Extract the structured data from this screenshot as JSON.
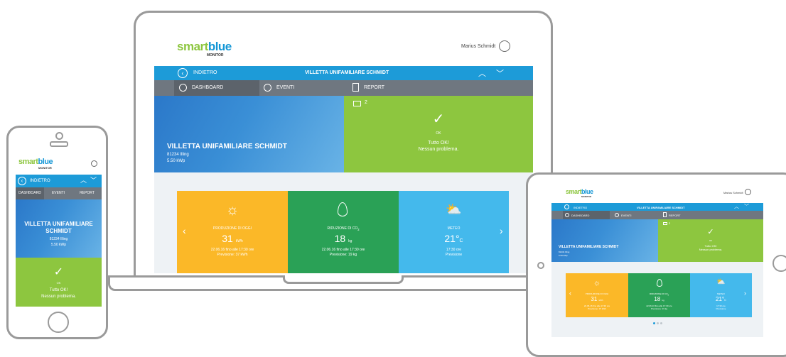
{
  "app": {
    "logo_part1": "smart",
    "logo_part2": "blue",
    "logo_sub": "MONITOR",
    "user_name": "Marius Schmidt"
  },
  "nav": {
    "back_label": "INDIETRO",
    "title": "VILLETTA UNIFAMILIARE SCHMIDT"
  },
  "tabs": [
    {
      "label": "DASHBOARD",
      "icon": "speedometer-icon"
    },
    {
      "label": "EVENTI",
      "icon": "clock-icon"
    },
    {
      "label": "REPORT",
      "icon": "document-icon"
    }
  ],
  "hero": {
    "title": "VILLETTA UNIFAMILIARE SCHMIDT",
    "address": "81234 Illing",
    "power": "5.50 kWp"
  },
  "status": {
    "message_count": "2",
    "state": "OK",
    "line1": "Tutto OK!",
    "line2": "Nessun problema."
  },
  "cards": [
    {
      "icon": "sun-icon",
      "title": "PRODUZIONE DI OGGI",
      "value": "31",
      "unit": "kWh",
      "line1": "22.06.16 fino alle 17:30 ore",
      "line2": "Previsione: 37 kWh"
    },
    {
      "icon": "leaf-icon",
      "title": "RIDUZIONE DI CO",
      "title_sub": "2",
      "value": "18",
      "unit": "kg",
      "line1": "22.06.16 fino alle 17:30 ore",
      "line2": "Previsione: 19 kg"
    },
    {
      "icon": "weather-sun-cloud-icon",
      "title": "METEO",
      "value": "21°",
      "unit": "C",
      "line1": "17:30 ore",
      "line2": "Previsione"
    }
  ],
  "mobile": {
    "tabs": [
      "DASHBOARD",
      "EVENTI",
      "REPORT"
    ],
    "hero_title": "VILLETTA UNIFAMILIARE SCHMIDT"
  },
  "colors": {
    "blue": "#1d9bd8",
    "green": "#8dc63f",
    "yellow": "#fbb828",
    "dark_green": "#2aa156",
    "light_blue": "#44b9ec",
    "gray": "#6f7780"
  }
}
